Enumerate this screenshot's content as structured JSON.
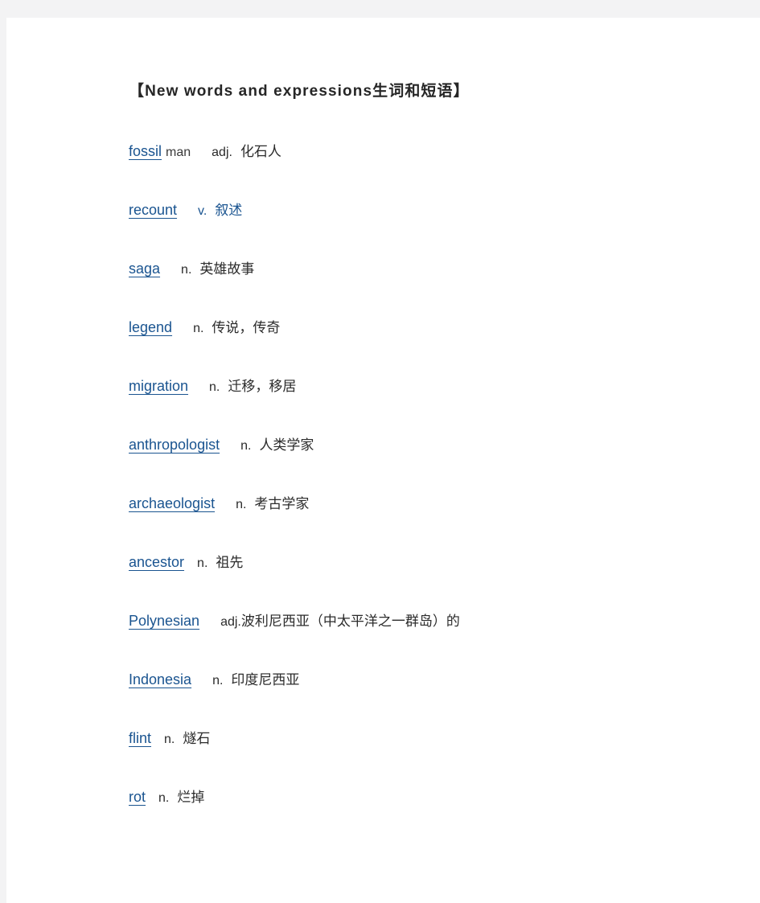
{
  "document": {
    "title": "【New words and expressions生词和短语】",
    "accent_color": "#1a5490",
    "text_color": "#2b2b2b",
    "page_background": "#ffffff",
    "canvas_background": "#f3f3f4"
  },
  "entries": [
    {
      "headword": "fossil",
      "extra": "man",
      "pos": "adj.",
      "meaning": "化石人",
      "blue_definition": false,
      "gap_after_word": "gap-md",
      "tight_meaning": false
    },
    {
      "headword": "recount",
      "extra": "",
      "pos": "v.",
      "meaning": "叙述",
      "blue_definition": true,
      "gap_after_word": "gap-md",
      "tight_meaning": false
    },
    {
      "headword": "saga",
      "extra": "",
      "pos": "n.",
      "meaning": "英雄故事",
      "blue_definition": false,
      "gap_after_word": "gap-md",
      "tight_meaning": false
    },
    {
      "headword": "legend",
      "extra": "",
      "pos": "n.",
      "meaning": "传说，传奇",
      "blue_definition": false,
      "gap_after_word": "gap-md",
      "tight_meaning": false
    },
    {
      "headword": "migration",
      "extra": "",
      "pos": "n.",
      "meaning": "迁移，移居",
      "blue_definition": false,
      "gap_after_word": "gap-md",
      "tight_meaning": false
    },
    {
      "headword": "anthropologist",
      "extra": "",
      "pos": "n.",
      "meaning": "人类学家",
      "blue_definition": false,
      "gap_after_word": "gap-md",
      "tight_meaning": false
    },
    {
      "headword": "archaeologist",
      "extra": "",
      "pos": "n.",
      "meaning": "考古学家",
      "blue_definition": false,
      "gap_after_word": "gap-md",
      "tight_meaning": false
    },
    {
      "headword": "ancestor",
      "extra": "",
      "pos": "n.",
      "meaning": "祖先",
      "blue_definition": false,
      "gap_after_word": "gap-sm",
      "tight_meaning": false
    },
    {
      "headword": "Polynesian",
      "extra": "",
      "pos": "adj.",
      "meaning": "波利尼西亚（中太平洋之一群岛）的",
      "blue_definition": false,
      "gap_after_word": "gap-md",
      "tight_meaning": true
    },
    {
      "headword": "Indonesia",
      "extra": "",
      "pos": "n.",
      "meaning": "印度尼西亚",
      "blue_definition": false,
      "gap_after_word": "gap-md",
      "tight_meaning": false
    },
    {
      "headword": "flint",
      "extra": "",
      "pos": "n.",
      "meaning": "燧石",
      "blue_definition": false,
      "gap_after_word": "gap-sm",
      "tight_meaning": false
    },
    {
      "headword": "rot",
      "extra": "",
      "pos": "n.",
      "meaning": "烂掉",
      "blue_definition": false,
      "gap_after_word": "gap-sm",
      "tight_meaning": false
    }
  ]
}
